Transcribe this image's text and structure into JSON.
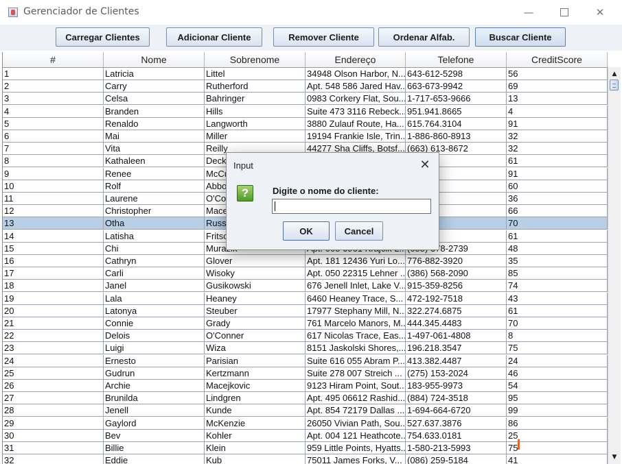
{
  "window": {
    "title": "Gerenciador de Clientes",
    "controls": {
      "minimize": "—",
      "close": "✕"
    }
  },
  "toolbar": {
    "buttons": [
      "Carregar Clientes",
      "Adicionar Cliente",
      "Remover Cliente",
      "Ordenar Alfab.",
      "Buscar Cliente"
    ]
  },
  "table": {
    "columns": [
      "#",
      "Nome",
      "Sobrenome",
      "Endereço",
      "Telefone",
      "CreditScore"
    ],
    "selected_row": "13",
    "rows": [
      [
        "1",
        "Latricia",
        "Littel",
        "34948 Olson Harbor, N...",
        "643-612-5298",
        "56"
      ],
      [
        "2",
        "Carry",
        "Rutherford",
        "Apt. 548 586 Jared Hav...",
        "663-673-9942",
        "69"
      ],
      [
        "3",
        "Celsa",
        "Bahringer",
        "0983 Corkery Flat, Sou...",
        "1-717-653-9666",
        "13"
      ],
      [
        "4",
        "Branden",
        "Hills",
        "Suite 473 3116 Rebeck...",
        "951.941.8665",
        "4"
      ],
      [
        "5",
        "Renaldo",
        "Langworth",
        "3880 Zulauf Route, Ha...",
        "615.764.3104",
        "91"
      ],
      [
        "6",
        "Mai",
        "Miller",
        "19194 Frankie Isle, Trin...",
        "1-886-860-8913",
        "32"
      ],
      [
        "7",
        "Vita",
        "Reilly",
        "44277 Sha Cliffs, Botsf...",
        "(663) 613-8672",
        "32"
      ],
      [
        "8",
        "Kathaleen",
        "Deck",
        "",
        "7230",
        "61"
      ],
      [
        "9",
        "Renee",
        "McCu",
        "",
        "7011",
        "91"
      ],
      [
        "10",
        "Rolf",
        "Abbot",
        "",
        "8253",
        "60"
      ],
      [
        "11",
        "Laurene",
        "O'Co",
        "",
        "5821",
        "36"
      ],
      [
        "12",
        "Christopher",
        "Mace",
        "",
        "3268",
        "66"
      ],
      [
        "13",
        "Otha",
        "Russ",
        "",
        "0154",
        "70"
      ],
      [
        "14",
        "Latisha",
        "Fritsc",
        "",
        "53-6062",
        "61"
      ],
      [
        "15",
        "Chi",
        "Murazik",
        "Apt. 005 6961 Krajcik L...",
        "(055) 378-2739",
        "48"
      ],
      [
        "16",
        "Cathryn",
        "Glover",
        "Apt. 181 12436 Yuri Lo...",
        "776-882-3920",
        "35"
      ],
      [
        "17",
        "Carli",
        "Wisoky",
        "Apt. 050 22315 Lehner ...",
        "(386) 568-2090",
        "85"
      ],
      [
        "18",
        "Janel",
        "Gusikowski",
        "676 Jenell Inlet, Lake V...",
        "915-359-8256",
        "74"
      ],
      [
        "19",
        "Lala",
        "Heaney",
        "6460 Heaney Trace, S...",
        "472-192-7518",
        "43"
      ],
      [
        "20",
        "Latonya",
        "Steuber",
        "17977 Stephany Mill, N...",
        "322.274.6875",
        "61"
      ],
      [
        "21",
        "Connie",
        "Grady",
        "761 Marcelo Manors, M...",
        "444.345.4483",
        "70"
      ],
      [
        "22",
        "Delois",
        "O'Conner",
        "617 Nicolas Trace, Eas...",
        "1-497-061-4808",
        "8"
      ],
      [
        "23",
        "Luigi",
        "Wiza",
        "8151 Jaskolski Shores,...",
        "196.218.3547",
        "75"
      ],
      [
        "24",
        "Ernesto",
        "Parisian",
        "Suite 616 055 Abram P...",
        "413.382.4487",
        "24"
      ],
      [
        "25",
        "Gudrun",
        "Kertzmann",
        "Suite 278 007 Streich ...",
        "(275) 153-2024",
        "46"
      ],
      [
        "26",
        "Archie",
        "Macejkovic",
        "9123 Hiram Point, Sout...",
        "183-955-9973",
        "54"
      ],
      [
        "27",
        "Brunilda",
        "Lindgren",
        "Apt. 495 06612 Rashid...",
        "(884) 724-3518",
        "95"
      ],
      [
        "28",
        "Jenell",
        "Kunde",
        "Apt. 854 72179 Dallas ...",
        "1-694-664-6720",
        "99"
      ],
      [
        "29",
        "Gaylord",
        "McKenzie",
        "26050 Vivian Path, Sou...",
        "527.637.3876",
        "86"
      ],
      [
        "30",
        "Bev",
        "Kohler",
        "Apt. 004 121 Heathcote...",
        "754.633.0181",
        "25"
      ],
      [
        "31",
        "Billie",
        "Klein",
        "959 Little Points, Hyatts...",
        "1-580-213-5993",
        "75"
      ],
      [
        "32",
        "Eddie",
        "Kub",
        "75011 James Forks, V...",
        "(086) 259-5184",
        "41"
      ]
    ]
  },
  "scrollbar": {
    "up_arrow": "▲",
    "down_arrow": "▼"
  },
  "dialog": {
    "title": "Input",
    "close": "✕",
    "icon_glyph": "?",
    "prompt": "Digite o nome do cliente:",
    "input_value": "",
    "ok_label": "OK",
    "cancel_label": "Cancel"
  }
}
